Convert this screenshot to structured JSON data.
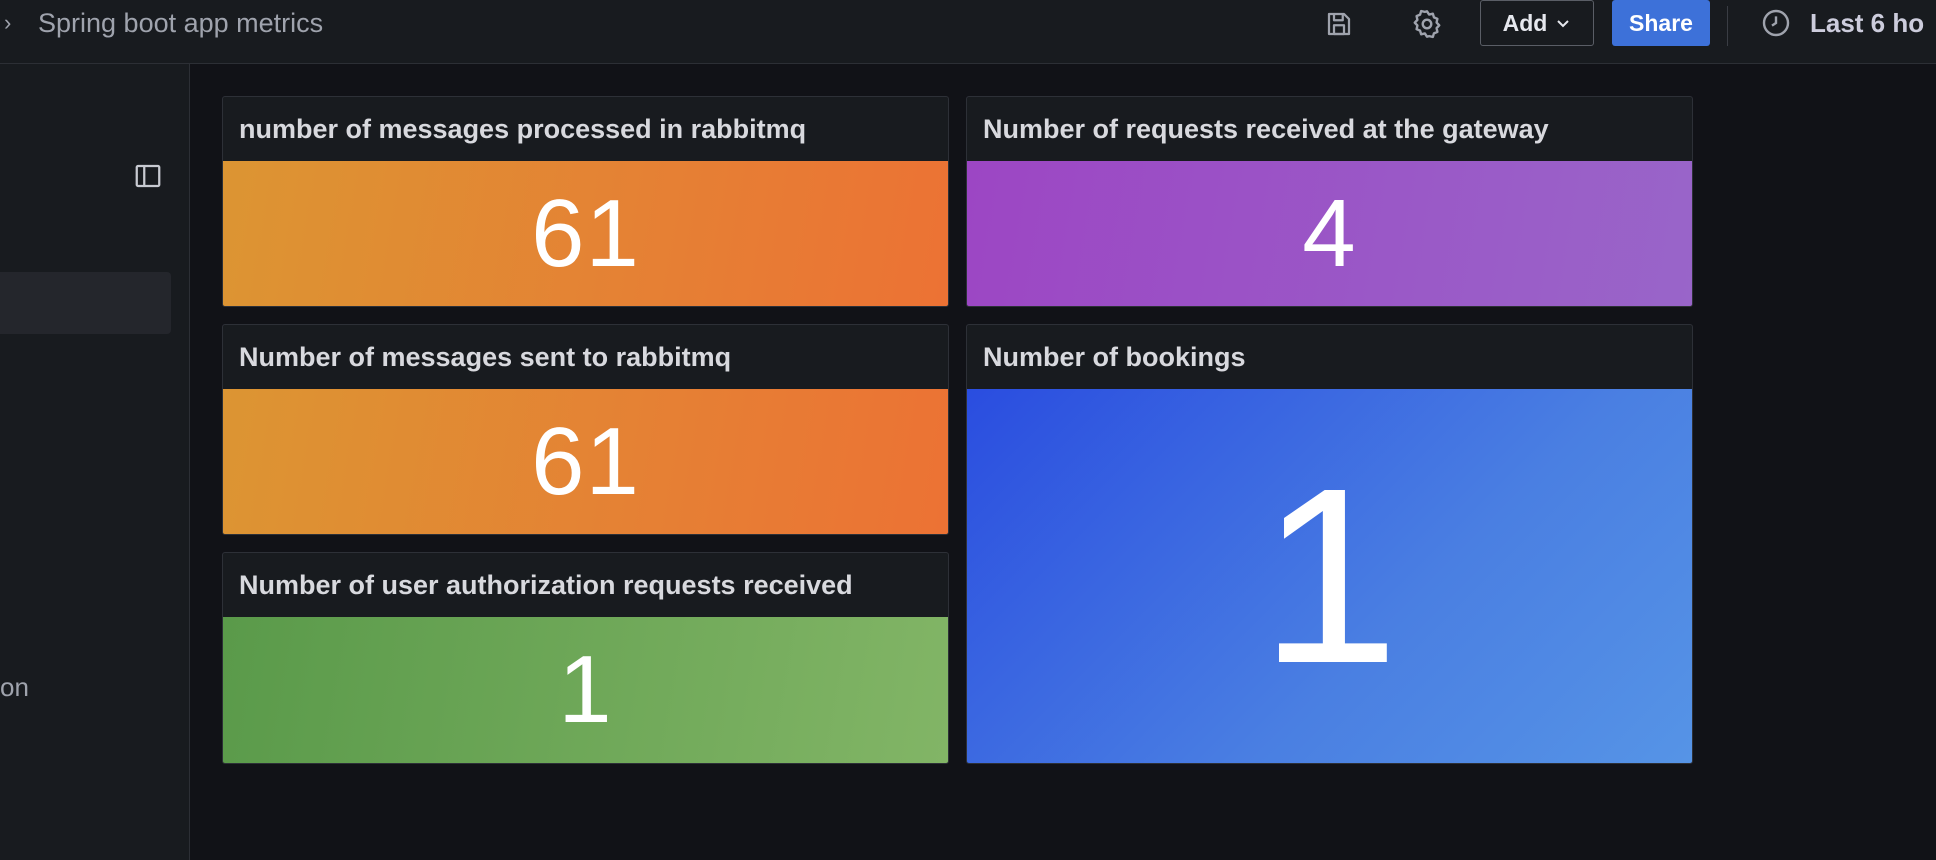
{
  "topbar": {
    "breadcrumb_chevron": "›",
    "dashboard_title": "Spring boot app metrics",
    "save_icon": "save-icon",
    "settings_icon": "gear-icon",
    "add_label": "Add",
    "share_label": "Share",
    "time_range_label": "Last 6 ho"
  },
  "sidebar": {
    "dock_icon": "sidebar-dock-icon",
    "partial_label": "on"
  },
  "panels": [
    {
      "title": "number of messages processed in rabbitmq",
      "value": "61",
      "color": "#e5853a"
    },
    {
      "title": "Number of requests received at the gateway",
      "value": "4",
      "color": "#9a56c6"
    },
    {
      "title": "Number of messages sent to rabbitmq",
      "value": "61",
      "color": "#e5853a"
    },
    {
      "title": "Number of bookings",
      "value": "1",
      "color": "#3d70e3"
    },
    {
      "title": "Number of user authorization requests received",
      "value": "1",
      "color": "#6ea85a"
    }
  ],
  "colors": {
    "background": "#111217",
    "panel_bg": "#181b1f",
    "share_button": "#3d71d9"
  }
}
